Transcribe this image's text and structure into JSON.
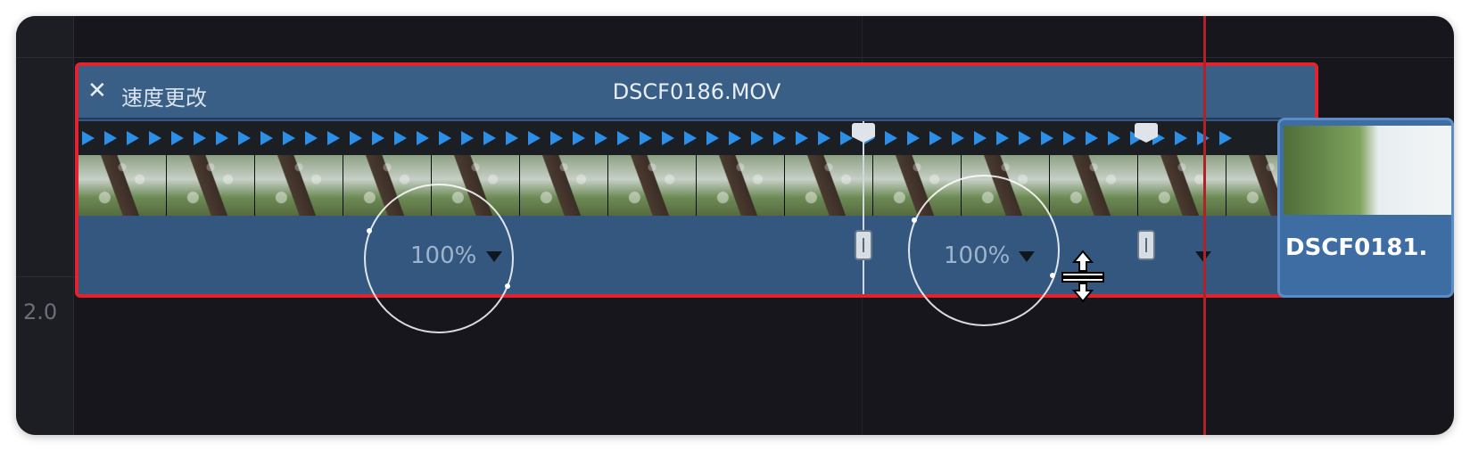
{
  "track": {
    "label": "2.0"
  },
  "clip": {
    "close_symbol": "✕",
    "speed_change_label": "速度更改",
    "name": "DSCF0186.MOV",
    "segments": [
      {
        "speed": "100%"
      },
      {
        "speed": "100%"
      },
      {
        "speed": ""
      }
    ]
  },
  "next_clip": {
    "name": "DSCF0181."
  },
  "colors": {
    "selection_border": "#e2232f",
    "playhead": "#b1212a",
    "speed_arrow": "#2b8fe8"
  },
  "icons": [
    "close-icon",
    "dropdown-arrow-icon",
    "speed-arrow-icon",
    "resize-cursor-icon"
  ]
}
